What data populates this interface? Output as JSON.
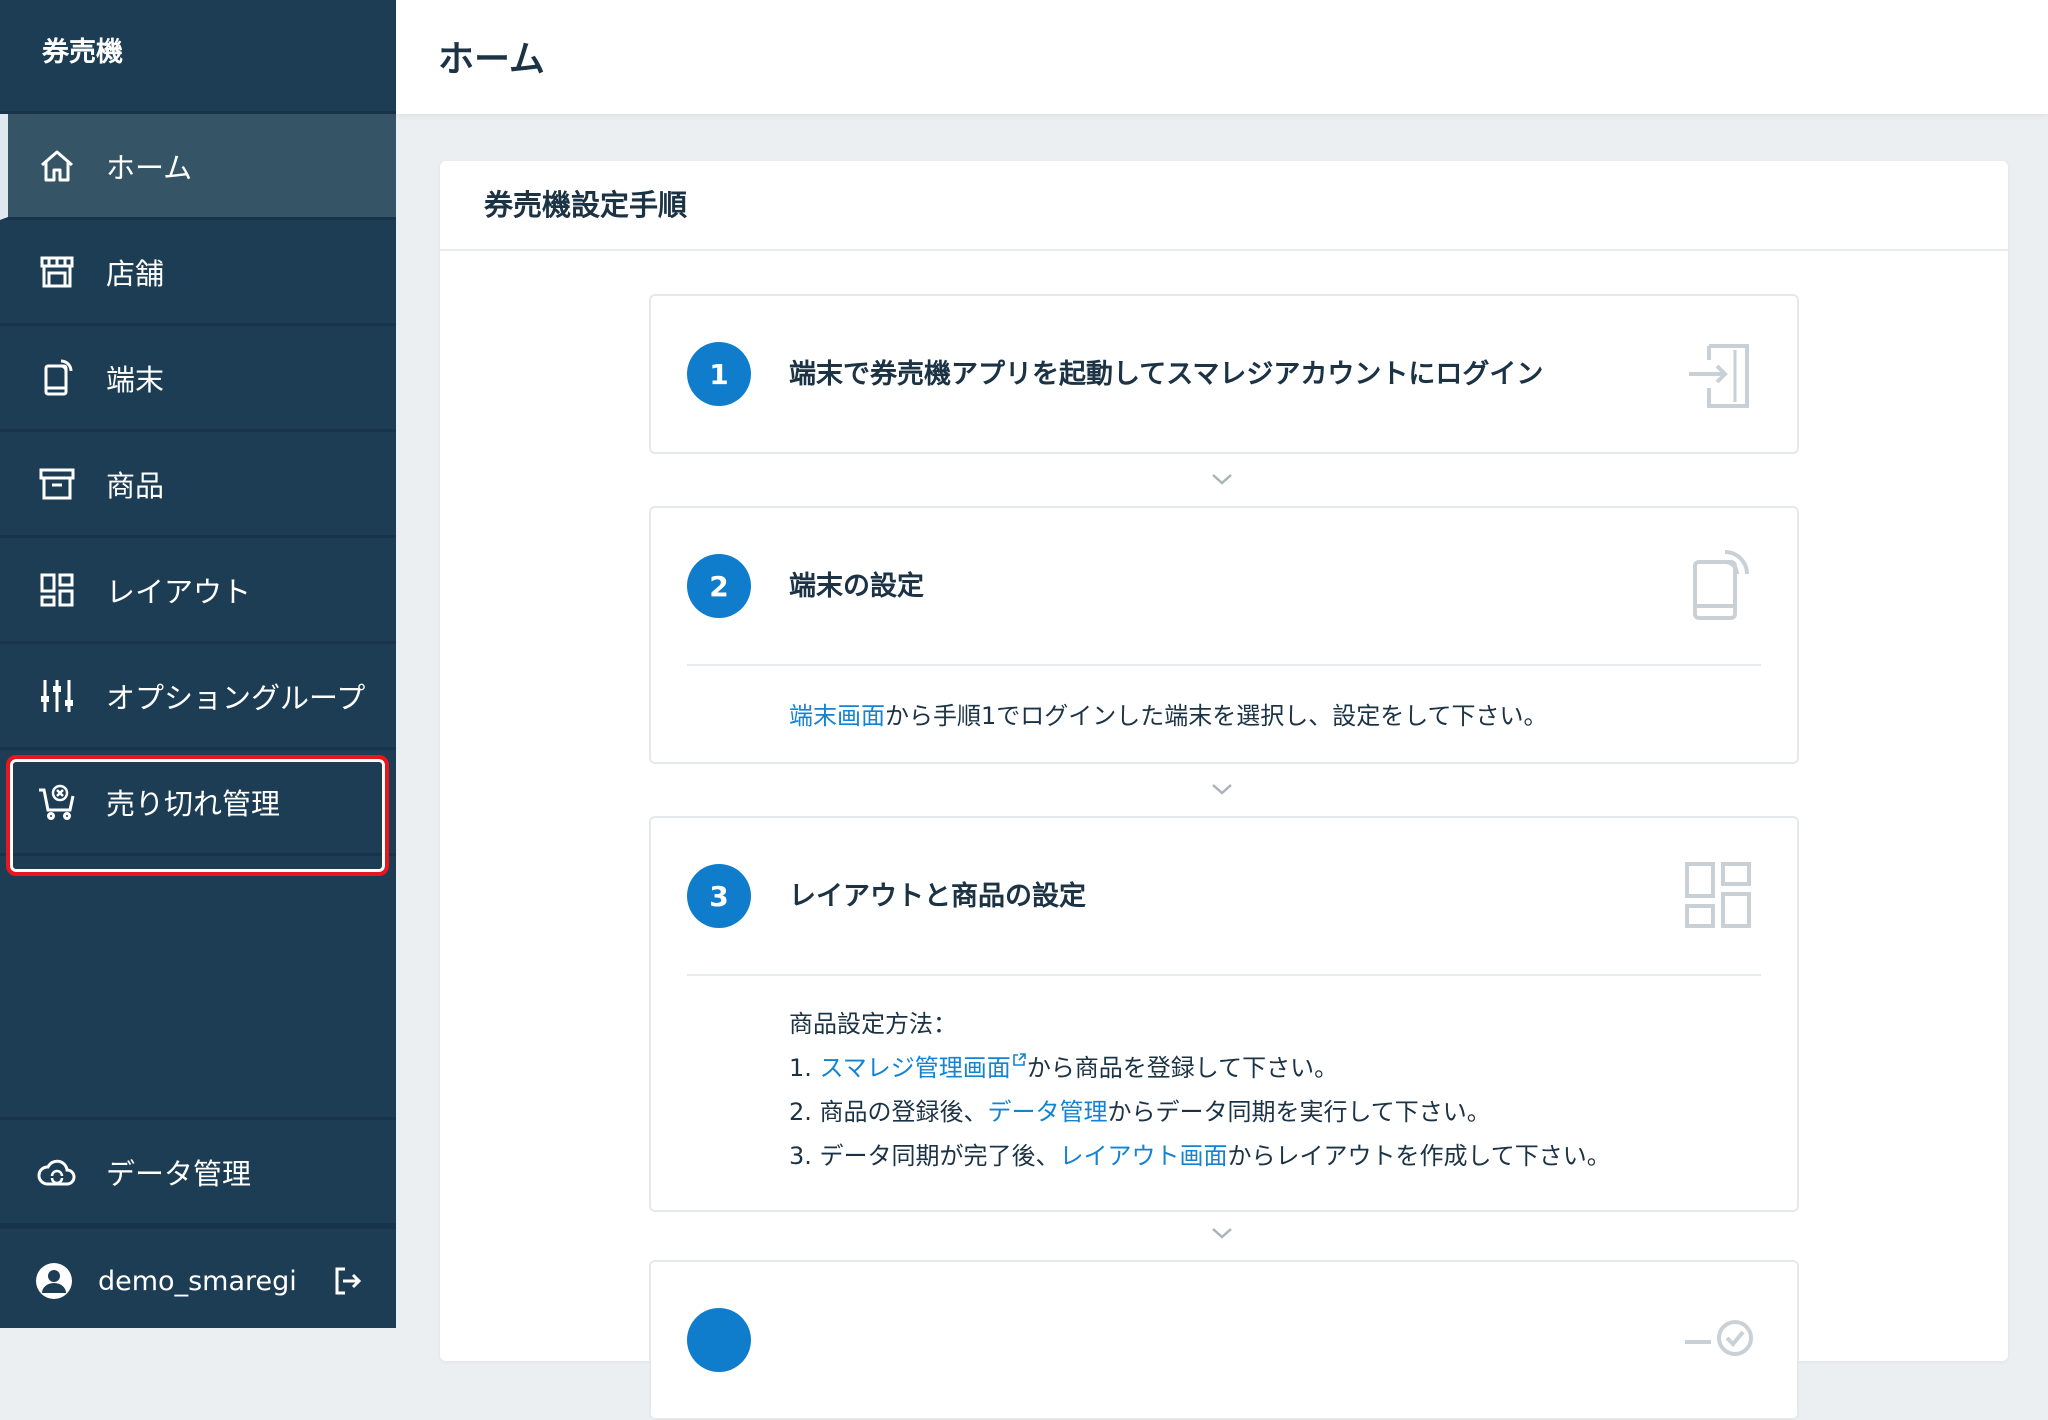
{
  "sidebar": {
    "app_title": "券売機",
    "items": [
      {
        "label": "ホーム",
        "icon": "home-icon"
      },
      {
        "label": "店舗",
        "icon": "store-icon"
      },
      {
        "label": "端末",
        "icon": "tablet-icon"
      },
      {
        "label": "商品",
        "icon": "box-icon"
      },
      {
        "label": "レイアウト",
        "icon": "layout-icon"
      },
      {
        "label": "オプショングループ",
        "icon": "sliders-icon"
      },
      {
        "label": "売り切れ管理",
        "icon": "cart-cancel-icon"
      }
    ],
    "data_management": "データ管理",
    "username": "demo_smaregi"
  },
  "header": {
    "title": "ホーム"
  },
  "card": {
    "title": "券売機設定手順",
    "steps": [
      {
        "number": "1",
        "title": "端末で券売機アプリを起動してスマレジアカウントにログイン"
      },
      {
        "number": "2",
        "title": "端末の設定",
        "body_link": "端末画面",
        "body_text": "から手順1でログインした端末を選択し、設定をして下さい。"
      },
      {
        "number": "3",
        "title": "レイアウトと商品の設定",
        "intro": "商品設定方法：",
        "line1_prefix": "1. ",
        "line1_link": "スマレジ管理画面",
        "line1_suffix": "から商品を登録して下さい。",
        "line2_prefix": "2. 商品の登録後、",
        "line2_link": "データ管理",
        "line2_suffix": "からデータ同期を実行して下さい。",
        "line3_prefix": "3. データ同期が完了後、",
        "line3_link": "レイアウト画面",
        "line3_suffix": "からレイアウトを作成して下さい。"
      }
    ]
  },
  "colors": {
    "sidebar_bg": "#1c3d54",
    "active_bg": "#355566",
    "accent": "#0f7dcc",
    "link": "#1483d1",
    "highlight": "#e8161f"
  }
}
